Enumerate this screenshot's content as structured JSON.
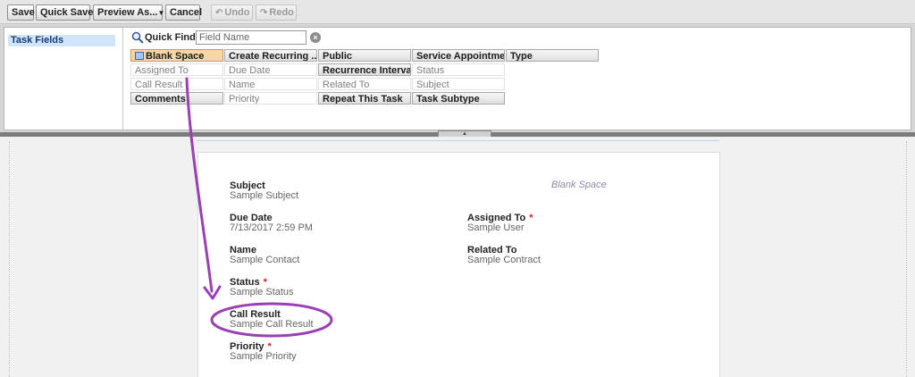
{
  "toolbar": {
    "save": "Save",
    "quick_save": "Quick Save",
    "preview_as": "Preview As...",
    "cancel": "Cancel",
    "undo": "Undo",
    "redo": "Redo"
  },
  "palette": {
    "categories": [
      "Task Fields"
    ],
    "quick_find": {
      "label": "Quick Find",
      "placeholder": "Field Name"
    },
    "fields": [
      [
        "Blank Space",
        "Create Recurring ...",
        "Public",
        "Service Appointme...",
        "Type"
      ],
      [
        "Assigned To",
        "Due Date",
        "Recurrence Interval",
        "Status"
      ],
      [
        "Call Result",
        "Name",
        "Related To",
        "Subject"
      ],
      [
        "Comments",
        "Priority",
        "Repeat This Task",
        "Task Subtype"
      ]
    ]
  },
  "layout": {
    "blank_space": "Blank Space",
    "subject": {
      "label": "Subject",
      "value": "Sample Subject"
    },
    "due_date": {
      "label": "Due Date",
      "value": "7/13/2017 2:59 PM"
    },
    "assigned_to": {
      "label": "Assigned To",
      "value": "Sample User"
    },
    "name": {
      "label": "Name",
      "value": "Sample Contact"
    },
    "related_to": {
      "label": "Related To",
      "value": "Sample Contract"
    },
    "status": {
      "label": "Status",
      "value": "Sample Status"
    },
    "call_result": {
      "label": "Call Result",
      "value": "Sample Call Result"
    },
    "priority": {
      "label": "Priority",
      "value": "Sample Priority"
    },
    "required_mark": "*"
  },
  "colors": {
    "annotation": "#9b3fb5",
    "required": "#d4242c",
    "selected_category": "#cfe6fa"
  },
  "icons": [
    "search-icon",
    "clear-icon",
    "undo-icon",
    "redo-icon",
    "dropdown-arrow-icon",
    "blank-space-icon",
    "resize-handle-icon"
  ]
}
